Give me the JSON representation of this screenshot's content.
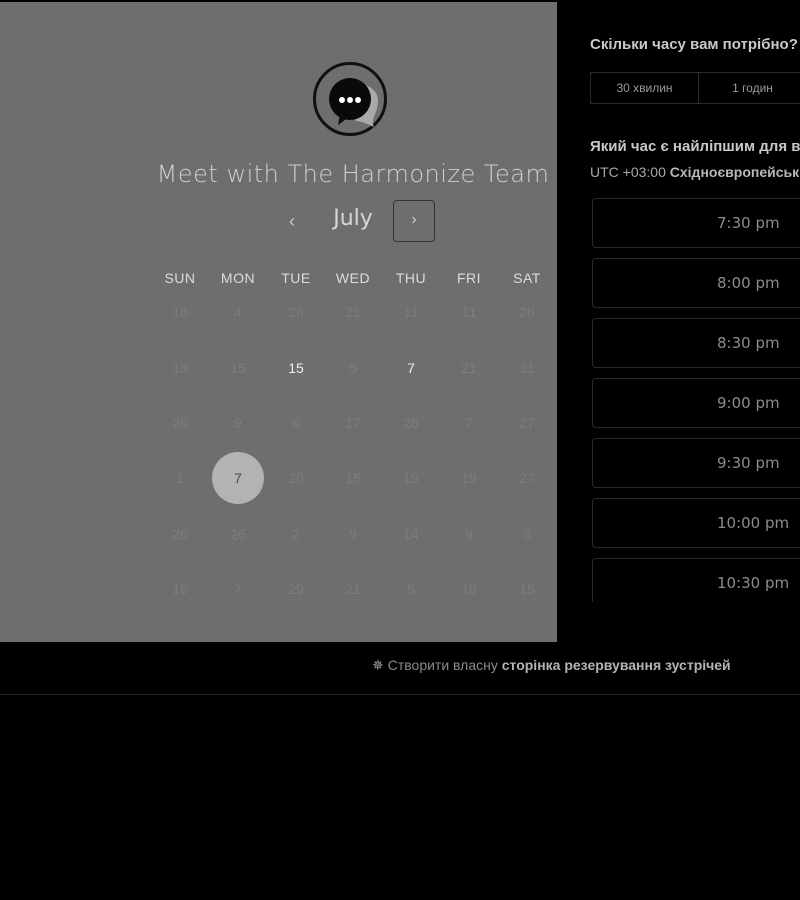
{
  "calendar": {
    "title": "Meet with The Harmonize Team",
    "month": "July",
    "prev_label": "‹",
    "next_label": "›",
    "weekdays": [
      "SUN",
      "MON",
      "TUE",
      "WED",
      "THU",
      "FRI",
      "SAT"
    ],
    "weeks": [
      [
        "16",
        "4",
        "28",
        "21",
        "11",
        "11",
        "28"
      ],
      [
        "13",
        "15",
        "15",
        "5",
        "7",
        "21",
        "31"
      ],
      [
        "26",
        "9",
        "6",
        "17",
        "28",
        "7",
        "27"
      ],
      [
        "1",
        "7",
        "20",
        "15",
        "19",
        "19",
        "27"
      ],
      [
        "26",
        "26",
        "2",
        "9",
        "14",
        "9",
        "3"
      ],
      [
        "16",
        "7",
        "29",
        "21",
        "5",
        "18",
        "15"
      ]
    ],
    "active_days": [
      [
        1,
        2
      ],
      [
        1,
        4
      ]
    ],
    "selected_day": [
      3,
      1
    ]
  },
  "booking": {
    "duration_question": "Скільки часу вам потрібно?",
    "durations": [
      "30 хвилин",
      "1 годин"
    ],
    "time_question": "Який час є найліпшим для вас?",
    "timezone_prefix": "UTC +03:00",
    "timezone_name": "Східноєвропейський час",
    "slots": [
      "7:30 pm",
      "8:00 pm",
      "8:30 pm",
      "9:00 pm",
      "9:30 pm",
      "10:00 pm",
      "10:30 pm"
    ]
  },
  "footer": {
    "icon": "hubspot-sprocket-icon",
    "prefix": "Створити власну",
    "bold": "сторінка резервування зустрічей"
  }
}
